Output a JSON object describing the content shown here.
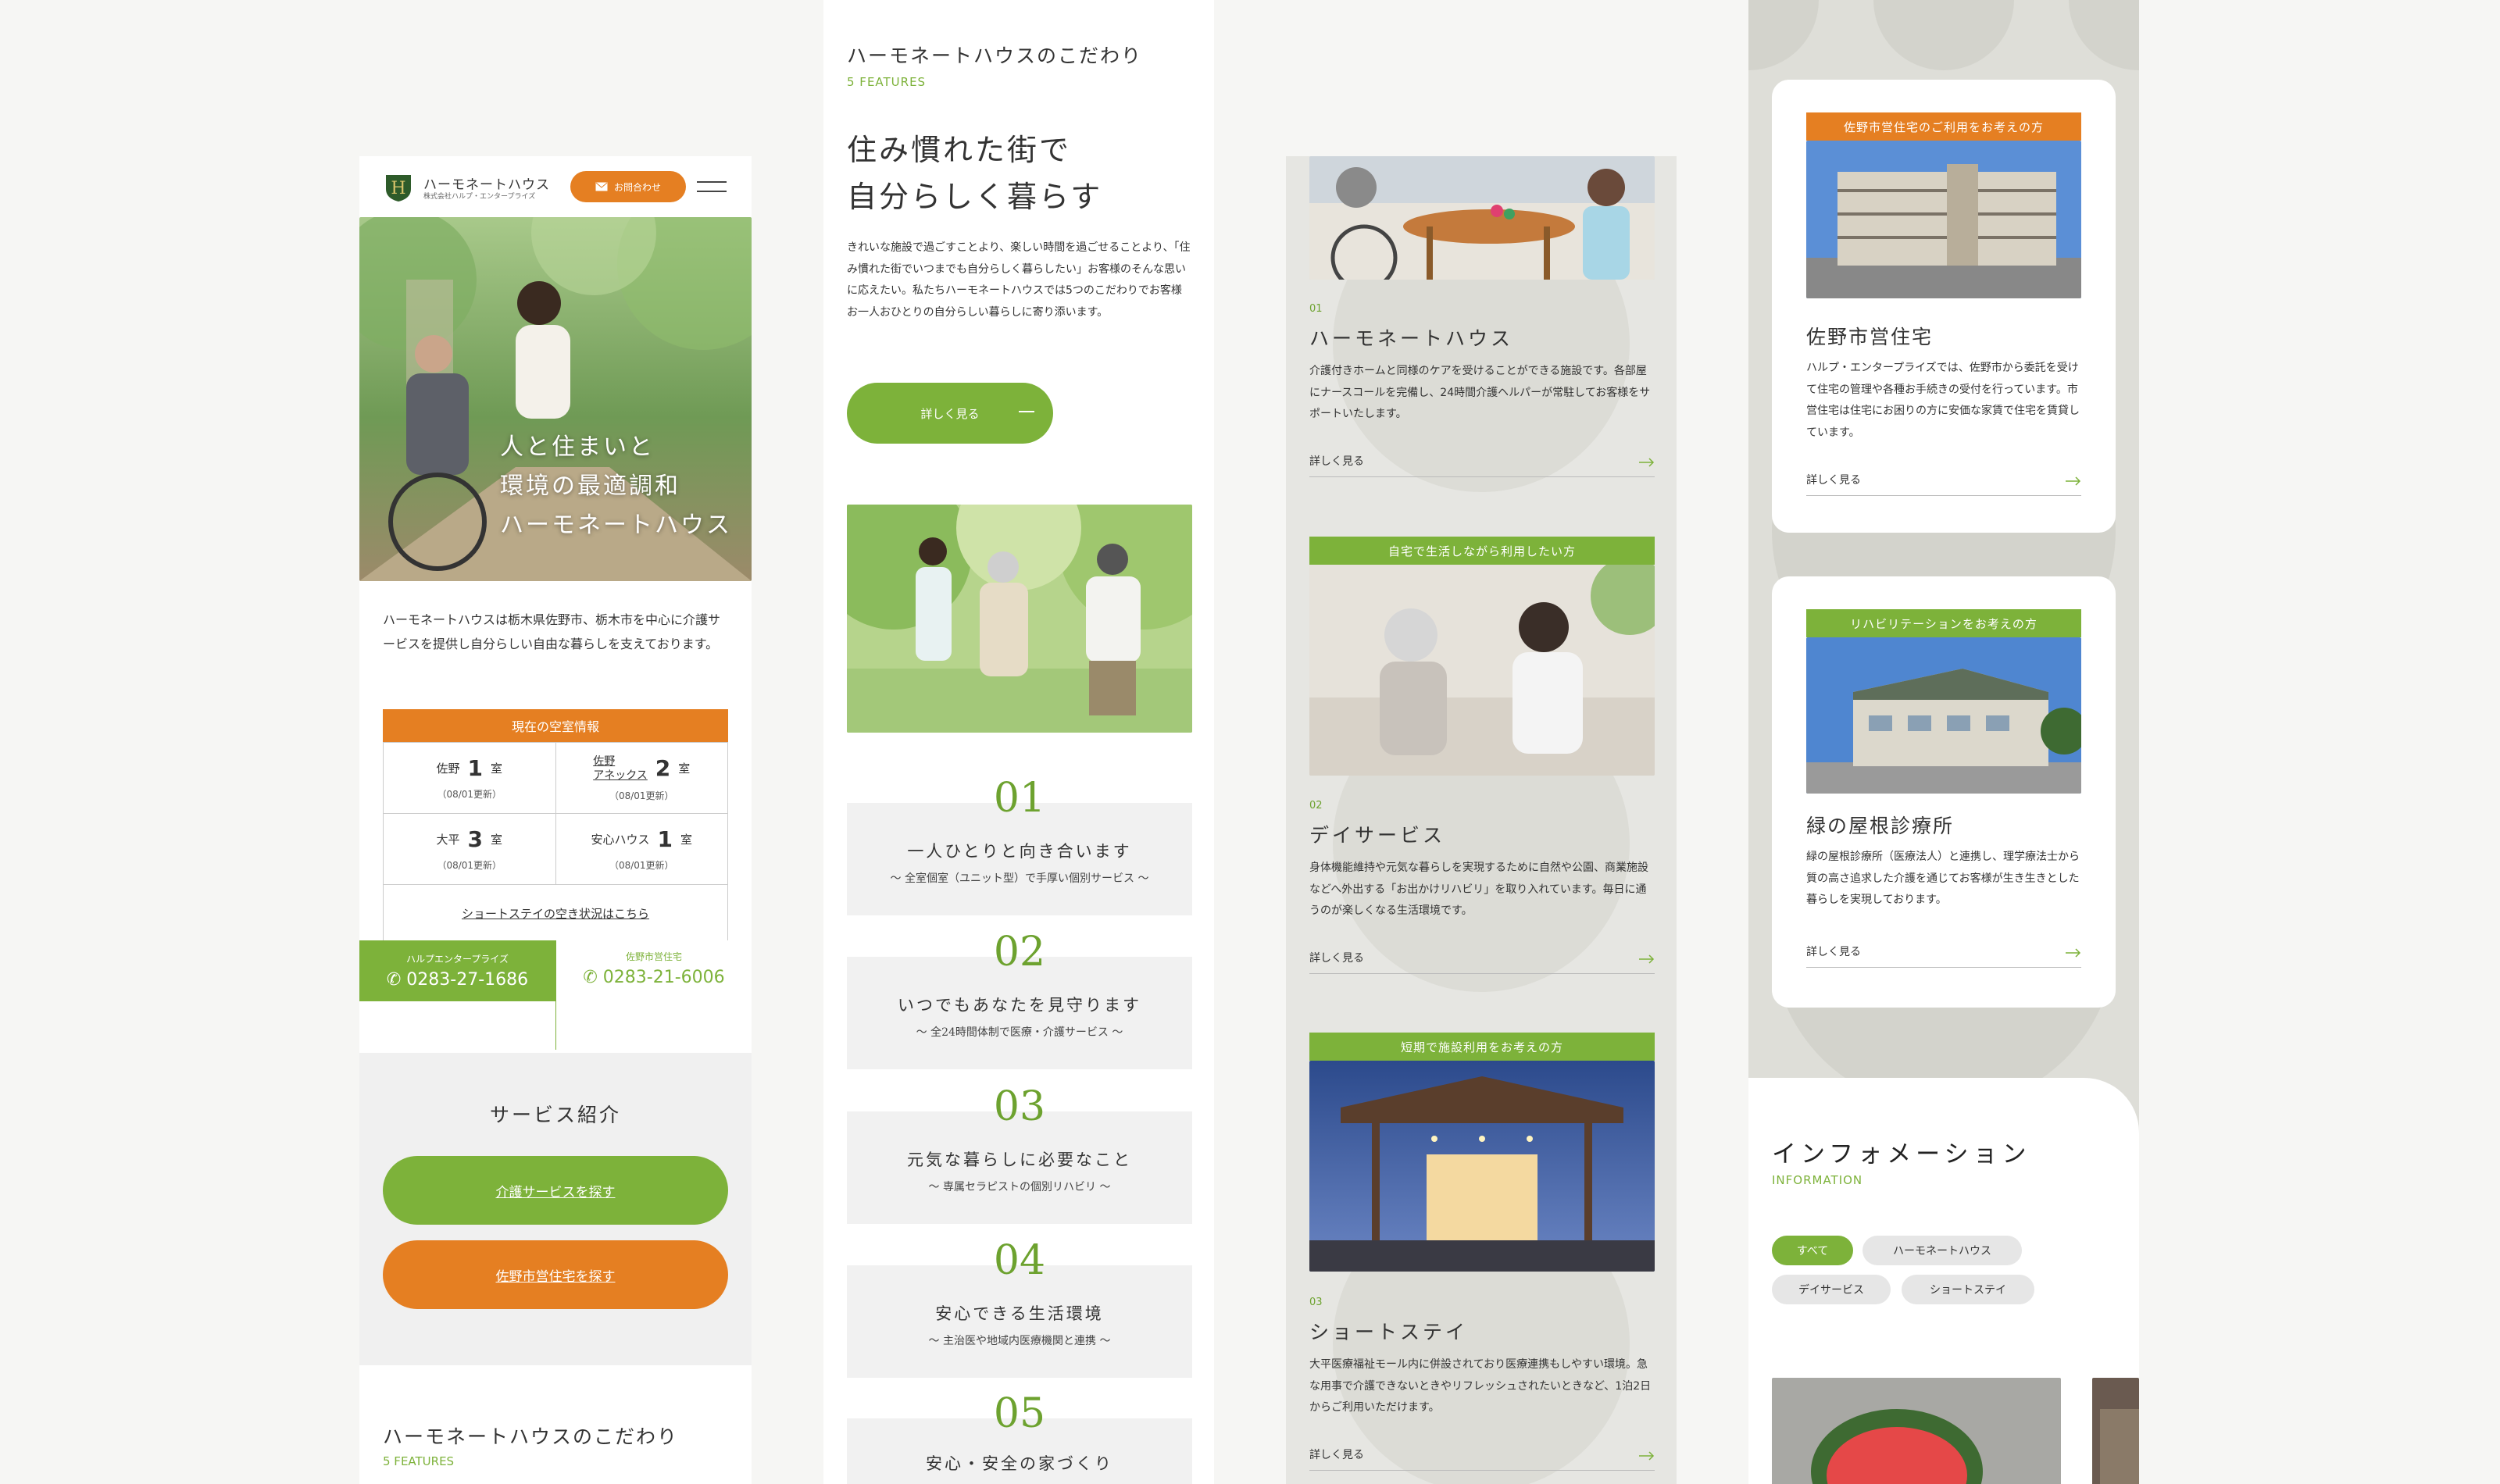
{
  "colors": {
    "accent_green": "#7db23a",
    "accent_orange": "#e57f22",
    "bg_gray": "#e6e6e2"
  },
  "mobile_home": {
    "brand": {
      "name": "ハーモネートハウス",
      "company": "株式会社ハルプ・エンタープライズ",
      "logo_letter": "H"
    },
    "header": {
      "contact_label": "お問合わせ",
      "contact_icon": "mail-icon",
      "menu_icon": "hamburger-menu-icon"
    },
    "hero": {
      "lines": [
        "人と住まいと",
        "環境の最適調和",
        "ハーモネートハウス"
      ]
    },
    "intro": "ハーモネートハウスは栃木県佐野市、栃木市を中心に介護サービスを提供し自分らしい自由な暮らしを支えております。",
    "vacancy": {
      "title": "現在の空室情報",
      "unit": "室",
      "cells": [
        {
          "name": "佐野",
          "count": "1",
          "date": "（08/01更新）"
        },
        {
          "name": "佐野\nアネックス",
          "count": "2",
          "date": "（08/01更新）"
        },
        {
          "name": "大平",
          "count": "3",
          "date": "（08/01更新）"
        },
        {
          "name": "安心ハウス",
          "count": "1",
          "date": "（08/01更新）"
        }
      ],
      "short_stay_link": "ショートステイの空き状況はこちら"
    },
    "tel": [
      {
        "label": "ハルプエンタープライズ",
        "number": "0283-27-1686"
      },
      {
        "label": "佐野市営住宅",
        "number": "0283-21-6006"
      }
    ],
    "services": {
      "title": "サービス紹介",
      "care_button": "介護サービスを探す",
      "housing_button": "佐野市営住宅を探す"
    },
    "features": {
      "title": "ハーモネートハウスのこだわり",
      "subtitle": "5 FEATURES"
    }
  },
  "features_page": {
    "title": "ハーモネートハウスのこだわり",
    "subtitle": "5 FEATURES",
    "heading_lines": [
      "住み慣れた街で",
      "自分らしく暮らす"
    ],
    "body": "きれいな施設で過ごすことより、楽しい時間を過ごせることより、「住み慣れた街でいつまでも自分らしく暮らしたい」お客様のそんな思いに応えたい。私たちハーモネートハウスでは5つのこだわりでお客様お一人おひとりの自分らしい暮らしに寄り添います。",
    "more_button": "詳しく見る",
    "items": [
      {
        "num": "01",
        "title": "一人ひとりと向き合います",
        "sub": "〜 全室個室（ユニット型）で手厚い個別サービス 〜"
      },
      {
        "num": "02",
        "title": "いつでもあなたを見守ります",
        "sub": "〜 全24時間体制で医療・介護サービス 〜"
      },
      {
        "num": "03",
        "title": "元気な暮らしに必要なこと",
        "sub": "〜 専属セラピストの個別リハビリ 〜"
      },
      {
        "num": "04",
        "title": "安心できる生活環境",
        "sub": "〜 主治医や地域内医療機関と連携 〜"
      },
      {
        "num": "05",
        "title": "安心・安全の家づくり",
        "sub": ""
      }
    ]
  },
  "services_page": {
    "more_label": "詳しく見る",
    "items": [
      {
        "band": "",
        "no": "01",
        "name": "ハーモネートハウス",
        "desc": "介護付きホームと同様のケアを受けることができる施設です。各部屋にナースコールを完備し、24時間介護ヘルパーが常駐してお客様をサポートいたします。"
      },
      {
        "band": "自宅で生活しながら利用したい方",
        "no": "02",
        "name": "デイサービス",
        "desc": "身体機能維持や元気な暮らしを実現するために自然や公園、商業施設などへ外出する「お出かけリハビリ」を取り入れています。毎日に通うのが楽しくなる生活環境です。"
      },
      {
        "band": "短期で施設利用をお考えの方",
        "no": "03",
        "name": "ショートステイ",
        "desc": "大平医療福祉モール内に併設されており医療連携もしやすい環境。急な用事で介護できないときやリフレッシュされたいときなど、1泊2日からご利用いただけます。"
      }
    ]
  },
  "other_page": {
    "more_label": "詳しく見る",
    "cards": [
      {
        "band": "佐野市営住宅のご利用をお考えの方",
        "name": "佐野市営住宅",
        "desc": "ハルプ・エンタープライズでは、佐野市から委託を受けて住宅の管理や各種お手続きの受付を行っています。市営住宅は住宅にお困りの方に安価な家賃で住宅を賃貸しています。"
      },
      {
        "band": "リハビリテーションをお考えの方",
        "name": "緑の屋根診療所",
        "desc": "緑の屋根診療所（医療法人）と連携し、理学療法士から質の高さ追求した介護を通じてお客様が生き生きとした暮らしを実現しております。"
      }
    ],
    "info": {
      "title": "インフォメーション",
      "subtitle": "INFORMATION",
      "tags": [
        "すべて",
        "ハーモネートハウス",
        "デイサービス",
        "ショートステイ"
      ]
    }
  }
}
